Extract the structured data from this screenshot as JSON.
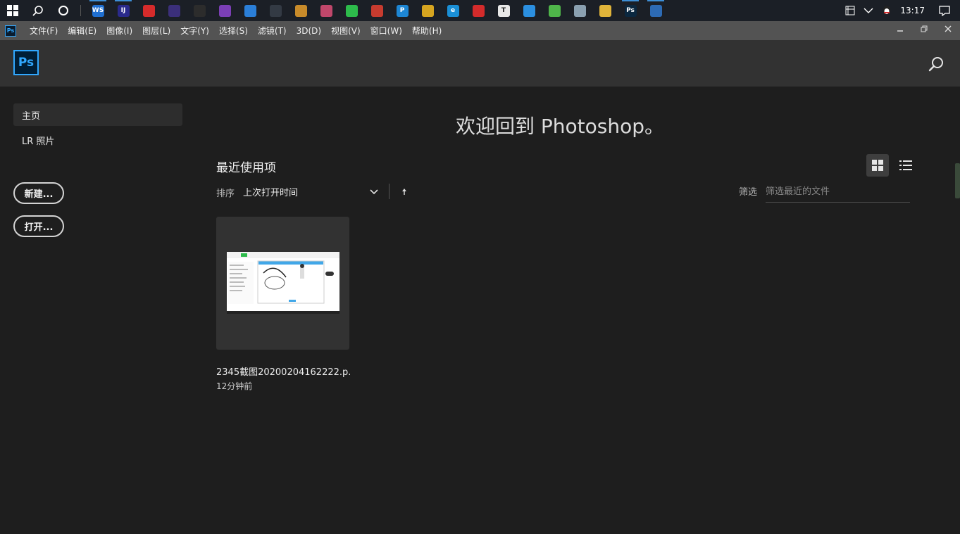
{
  "taskbar": {
    "apps": [
      {
        "name": "webstorm-icon",
        "label": "WS",
        "color": "#1f6fd1",
        "running": true
      },
      {
        "name": "intellij-icon",
        "label": "IJ",
        "color": "#2a2a8c",
        "running": true
      },
      {
        "name": "app-red-icon",
        "label": "",
        "color": "#d62b2b",
        "running": false
      },
      {
        "name": "eclipse-icon",
        "label": "",
        "color": "#3b2f7a",
        "running": false
      },
      {
        "name": "terminal-icon",
        "label": "",
        "color": "#2c2c2c",
        "running": false
      },
      {
        "name": "app-purple-icon",
        "label": "",
        "color": "#7b3fb5",
        "running": false
      },
      {
        "name": "app-blue-icon",
        "label": "",
        "color": "#2b7fd8",
        "running": false
      },
      {
        "name": "command-icon",
        "label": "",
        "color": "#333a44",
        "running": false
      },
      {
        "name": "paint-icon",
        "label": "",
        "color": "#c88b2a",
        "running": false
      },
      {
        "name": "palette-icon",
        "label": "",
        "color": "#c0476b",
        "running": false
      },
      {
        "name": "wechat-icon",
        "label": "",
        "color": "#2dbb4b",
        "running": false
      },
      {
        "name": "qq-icon",
        "label": "",
        "color": "#c63b2f",
        "running": false
      },
      {
        "name": "app-p-icon",
        "label": "P",
        "color": "#1d86d4",
        "running": false
      },
      {
        "name": "chrome-icon",
        "label": "",
        "color": "#d6a520",
        "running": false
      },
      {
        "name": "ie-icon",
        "label": "e",
        "color": "#1a8fd6",
        "running": false
      },
      {
        "name": "netease-music-icon",
        "label": "",
        "color": "#d42b2b",
        "running": false
      },
      {
        "name": "typora-icon",
        "label": "T",
        "color": "#e8e8e8",
        "running": false
      },
      {
        "name": "vscode-icon",
        "label": "",
        "color": "#2b8fe0",
        "running": false
      },
      {
        "name": "app-flower-icon",
        "label": "",
        "color": "#4fb54a",
        "running": false
      },
      {
        "name": "image-viewer-icon",
        "label": "",
        "color": "#8aa0b0",
        "running": false
      },
      {
        "name": "file-explorer-icon",
        "label": "",
        "color": "#e0b43a",
        "running": false
      },
      {
        "name": "photoshop-icon",
        "label": "Ps",
        "color": "#0b2840",
        "running": true,
        "active": true
      },
      {
        "name": "remote-desktop-icon",
        "label": "",
        "color": "#2d6bb5",
        "running": true
      }
    ],
    "time": "13:17"
  },
  "menubar": {
    "items": [
      "文件(F)",
      "编辑(E)",
      "图像(I)",
      "图层(L)",
      "文字(Y)",
      "选择(S)",
      "滤镜(T)",
      "3D(D)",
      "视图(V)",
      "窗口(W)",
      "帮助(H)"
    ]
  },
  "header": {
    "logo_text": "Ps"
  },
  "sidebar": {
    "home": "主页",
    "lr_photos": "LR 照片",
    "new_button": "新建...",
    "open_button": "打开..."
  },
  "main": {
    "welcome": "欢迎回到 Photoshop。",
    "recent_title": "最近使用项",
    "sort_label": "排序",
    "sort_value": "上次打开时间",
    "filter_label": "筛选",
    "filter_placeholder": "筛选最近的文件",
    "recent_files": [
      {
        "name": "2345截图20200204162222.p...",
        "time": "12分钟前"
      }
    ]
  },
  "colors": {
    "accent": "#31a8ff",
    "background": "#1e1e1e",
    "header": "#323232",
    "menubar": "#535353"
  }
}
